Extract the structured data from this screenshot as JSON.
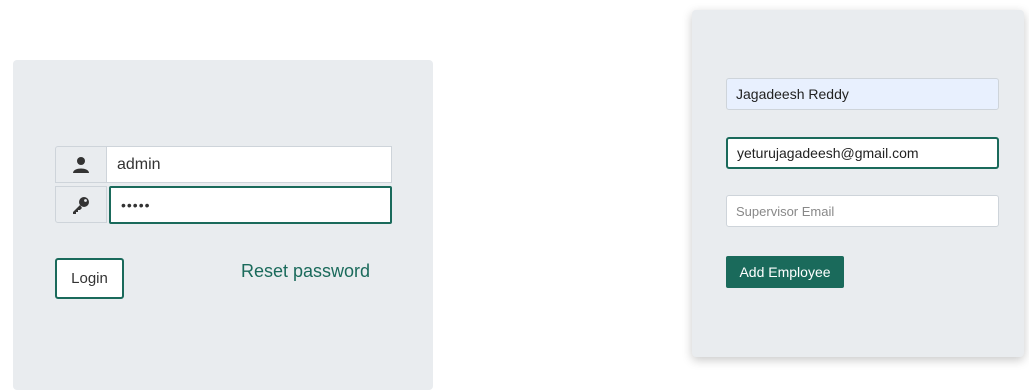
{
  "login": {
    "username_value": "admin",
    "password_value": "•••••",
    "login_label": "Login",
    "reset_label": "Reset password",
    "icons": [
      "user-icon",
      "key-icon"
    ]
  },
  "employee_form": {
    "name_value": "Jagadeesh Reddy",
    "email_value": "yeturujagadeesh@gmail.com",
    "supervisor_placeholder": "Supervisor Email",
    "add_label": "Add Employee"
  },
  "colors": {
    "accent": "#1a6a5b",
    "panel_bg": "#e9ecef",
    "autofill_bg": "#e8f0fe"
  }
}
